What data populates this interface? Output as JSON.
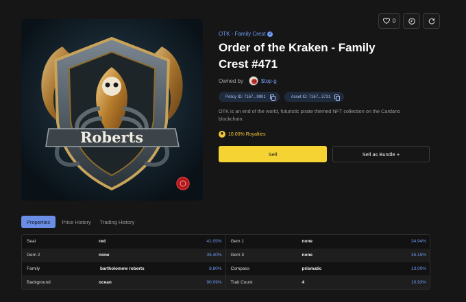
{
  "toolbar": {
    "like_count": "0",
    "like_icon": "heart-icon",
    "clock_icon": "clock-icon",
    "refresh_icon": "refresh-icon"
  },
  "collection": {
    "name": "OTK - Family Crest",
    "verified_icon": "verified-badge-icon"
  },
  "title": "Order of the Kraken - Family Crest #471",
  "owner": {
    "label": "Owned by",
    "name": "$top-g"
  },
  "ids": [
    {
      "label": "Policy ID: 7167...9901"
    },
    {
      "label": "Asset ID: 7167...3731"
    }
  ],
  "description": "OTK is an end of the world, futuristic pirate themed NFT collection on the Cardano blockchain.",
  "royalties": "10.00% Royalties",
  "actions": {
    "sell": "Sell",
    "bundle": "Sell as Bundle +"
  },
  "tabs": [
    "Properties",
    "Price History",
    "Trading History"
  ],
  "image": {
    "banner_text": "Roberts"
  },
  "attributes_left": [
    {
      "name": "Seal",
      "value": "red",
      "pct": "41.05%"
    },
    {
      "name": "Gem 2",
      "value": "none",
      "pct": "35.40%"
    },
    {
      "name": "Family",
      "value": "bartholomew roberts",
      "pct": "8.80%"
    },
    {
      "name": "Background",
      "value": "ocean",
      "pct": "90.09%"
    }
  ],
  "attributes_right": [
    {
      "name": "Gem 1",
      "value": "none",
      "pct": "34.94%"
    },
    {
      "name": "Gem 3",
      "value": "none",
      "pct": "35.15%"
    },
    {
      "name": "Compass",
      "value": "prismatic",
      "pct": "13.00%"
    },
    {
      "name": "Trait Count",
      "value": "4",
      "pct": "10.93%"
    }
  ],
  "colors": {
    "accent": "#6f9cf5",
    "sell": "#f4d333",
    "gold": "#f3c53a",
    "background": "#161616"
  }
}
